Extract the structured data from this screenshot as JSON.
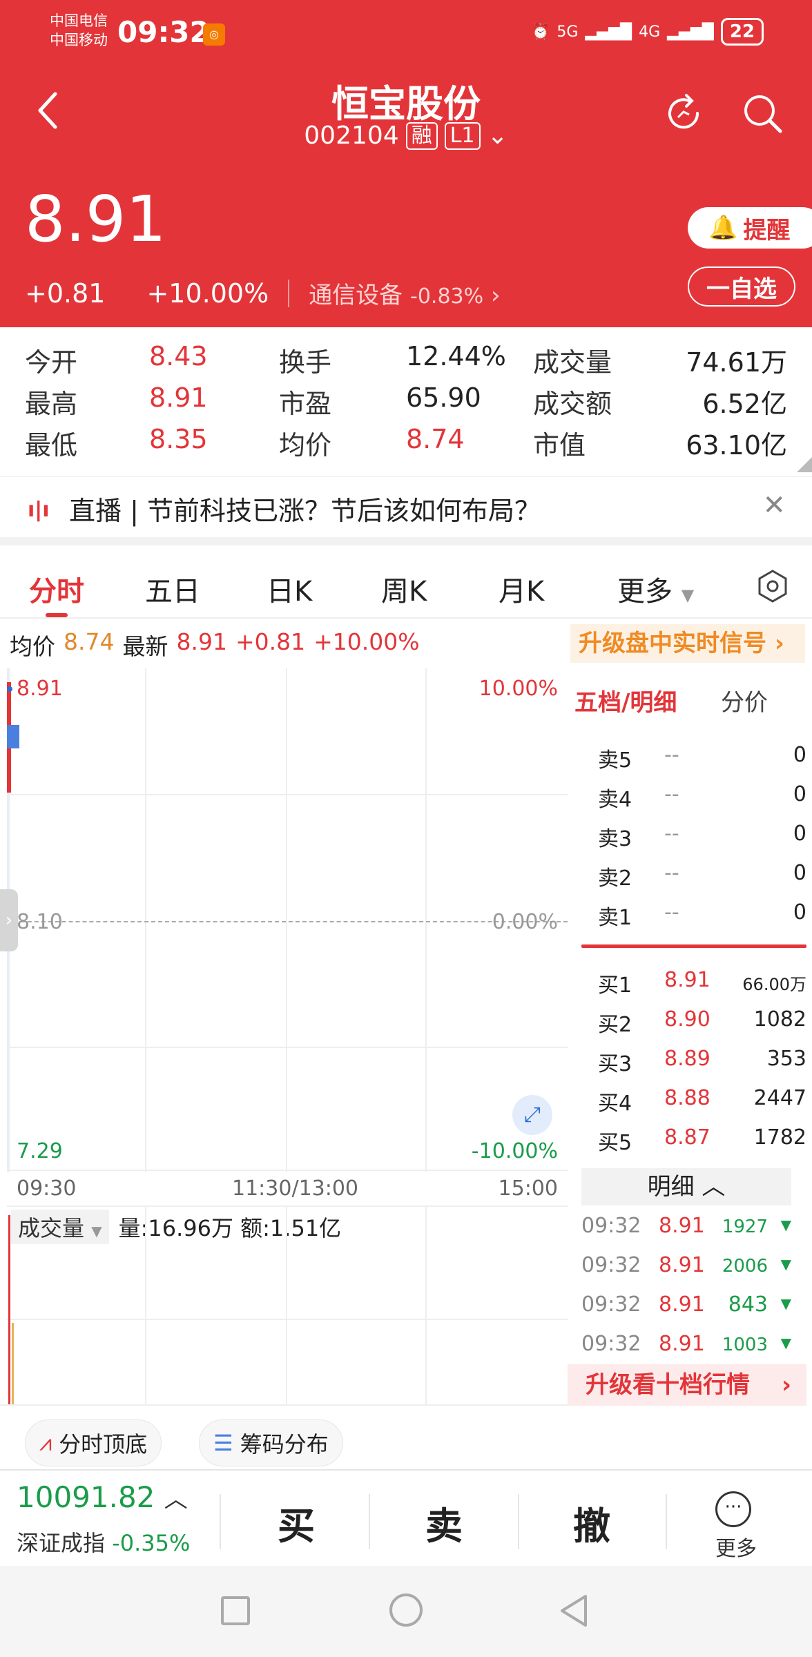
{
  "status": {
    "carrier1": "中国电信",
    "carrier2": "中国移动",
    "time": "09:32",
    "net1": "5G",
    "net2": "4G",
    "battery": "22"
  },
  "header": {
    "title": "恒宝股份",
    "code": "002104",
    "tag1": "融",
    "tag2": "L1"
  },
  "quote": {
    "price": "8.91",
    "change": "+0.81",
    "change_pct": "+10.00%",
    "sector": "通信设备",
    "sector_change": "-0.83%",
    "remind_label": "提醒",
    "watch_label": "一自选"
  },
  "stats": {
    "open_label": "今开",
    "open": "8.43",
    "turnover_label": "换手",
    "turnover": "12.44%",
    "volume_label": "成交量",
    "volume": "74.61万",
    "high_label": "最高",
    "high": "8.91",
    "pe_label": "市盈",
    "pe": "65.90",
    "amount_label": "成交额",
    "amount": "6.52亿",
    "low_label": "最低",
    "low": "8.35",
    "avg_label": "均价",
    "avg": "8.74",
    "mcap_label": "市值",
    "mcap": "63.10亿"
  },
  "live": {
    "text": "直播 | 节前科技已涨？节后该如何布局？"
  },
  "tabs": [
    "分时",
    "五日",
    "日K",
    "周K",
    "月K",
    "更多"
  ],
  "chart_info": {
    "avg_label": "均价",
    "avg": "8.74",
    "latest_label": "最新",
    "latest": "8.91",
    "change": "+0.81",
    "change_pct": "+10.00%",
    "upgrade_signal": "升级盘中实时信号"
  },
  "chart": {
    "top_price": "8.91",
    "top_pct": "10.00%",
    "mid_price": "8.10",
    "mid_pct": "0.00%",
    "bottom_price": "7.29",
    "bottom_pct": "-10.00%",
    "t_start": "09:30",
    "t_mid": "11:30/13:00",
    "t_end": "15:00",
    "vol_tag": "成交量",
    "vol_info": "量:16.96万 额:1.51亿"
  },
  "orderbook": {
    "tab1": "五档/明细",
    "tab2": "分价",
    "asks": [
      {
        "label": "卖5",
        "price": "--",
        "vol": "0"
      },
      {
        "label": "卖4",
        "price": "--",
        "vol": "0"
      },
      {
        "label": "卖3",
        "price": "--",
        "vol": "0"
      },
      {
        "label": "卖2",
        "price": "--",
        "vol": "0"
      },
      {
        "label": "卖1",
        "price": "--",
        "vol": "0"
      }
    ],
    "bids": [
      {
        "label": "买1",
        "price": "8.91",
        "vol": "66.00万"
      },
      {
        "label": "买2",
        "price": "8.90",
        "vol": "1082"
      },
      {
        "label": "买3",
        "price": "8.89",
        "vol": "353"
      },
      {
        "label": "买4",
        "price": "8.88",
        "vol": "2447"
      },
      {
        "label": "买5",
        "price": "8.87",
        "vol": "1782"
      }
    ],
    "detail_label": "明细",
    "trades": [
      {
        "time": "09:32",
        "price": "8.91",
        "vol": "1927"
      },
      {
        "time": "09:32",
        "price": "8.91",
        "vol": "2006"
      },
      {
        "time": "09:32",
        "price": "8.91",
        "vol": "843"
      },
      {
        "time": "09:32",
        "price": "8.91",
        "vol": "1003"
      }
    ],
    "upgrade_ten": "升级看十档行情"
  },
  "pills": {
    "fenshi": "分时顶底",
    "chouma": "筹码分布"
  },
  "bottom": {
    "index_value": "10091.82",
    "index_name": "深证成指",
    "index_change": "-0.35%",
    "buy": "买",
    "sell": "卖",
    "cancel": "撤",
    "more": "更多"
  }
}
